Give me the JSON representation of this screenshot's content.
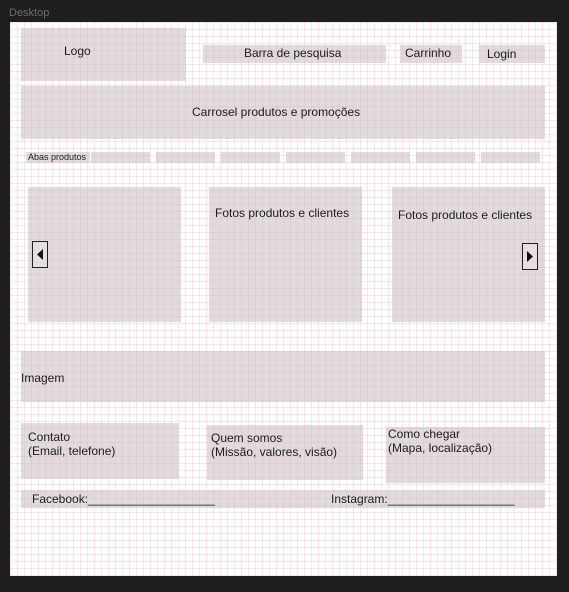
{
  "frame": {
    "title": "Desktop"
  },
  "header": {
    "logo": "Logo",
    "search": "Barra de pesquisa",
    "cart": "Carrinho",
    "login": "Login"
  },
  "carousel": {
    "label": "Carrosel produtos e promoções"
  },
  "tabs": {
    "label": "Abas produtos"
  },
  "gallery": {
    "card2": "Fotos produtos e clientes",
    "card3": "Fotos produtos e clientes"
  },
  "banner": {
    "label": "Imagem"
  },
  "info": {
    "contact_title": "Contato",
    "contact_sub": "(Email, telefone)",
    "about_title": "Quem somos",
    "about_sub": "(Missão, valores, visão)",
    "location_title": "Como chegar",
    "location_sub": "(Mapa, localização)"
  },
  "social": {
    "facebook": "Facebook:___________________",
    "instagram": "Instagram:___________________"
  }
}
